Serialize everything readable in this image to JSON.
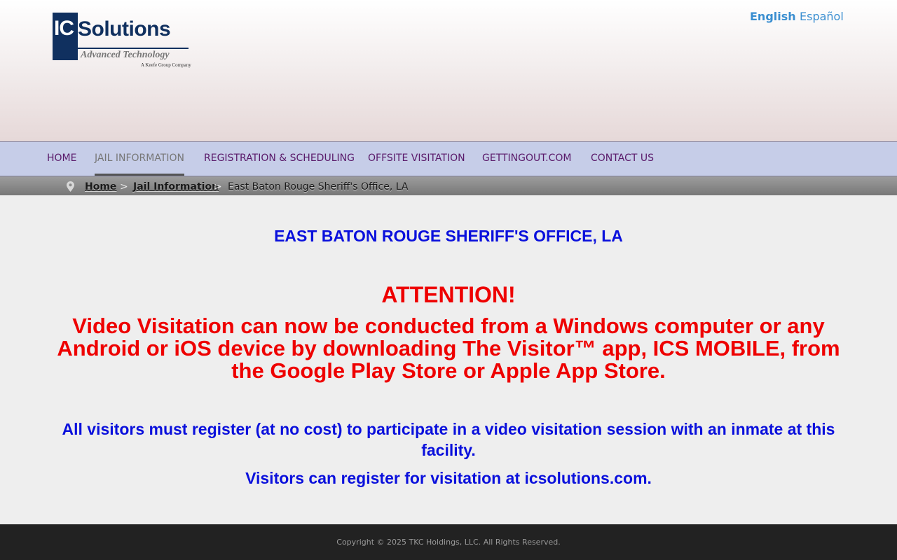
{
  "logo": {
    "ic": "IC",
    "rest": "Solutions",
    "tagline": "Advanced Technology",
    "sub": "A Keefe Group Company"
  },
  "languages": {
    "english": "English",
    "spanish": "Español"
  },
  "nav": {
    "home": "HOME",
    "jail_information": "JAIL INFORMATION",
    "registration": "REGISTRATION & SCHEDULING",
    "offsite": "OFFSITE VISITATION",
    "gettingout": "GETTINGOUT.COM",
    "contact": "CONTACT US"
  },
  "breadcrumb": {
    "icon": "map-pin-icon",
    "home": "Home",
    "separator": ">",
    "jail_information": "Jail Information",
    "current": "East Baton Rouge Sheriff's Office, LA"
  },
  "main": {
    "facility_title": "EAST BATON ROUGE SHERIFF'S OFFICE, LA",
    "attention": "ATTENTION!",
    "video_message": "Video Visitation can now be conducted from a Windows computer or any Android or iOS device by downloading The Visitor™ app, ICS MOBILE, from the Google Play Store or Apple App Store.",
    "register_message": "All visitors must register (at no cost) to participate in a video visitation session with an inmate at this facility.",
    "register_site": "Visitors can register for visitation at icsolutions.com."
  },
  "footer": {
    "copyright": "Copyright © 2025 TKC Holdings, LLC. All Rights Reserved."
  },
  "colors": {
    "brand_navy": "#10305f",
    "nav_bg": "#c6cde8",
    "nav_text": "#5a1a6a",
    "alert_red": "#ee0000",
    "info_blue": "#0a10dc",
    "lang_link": "#3a8ed0",
    "footer_bg": "#222222"
  }
}
